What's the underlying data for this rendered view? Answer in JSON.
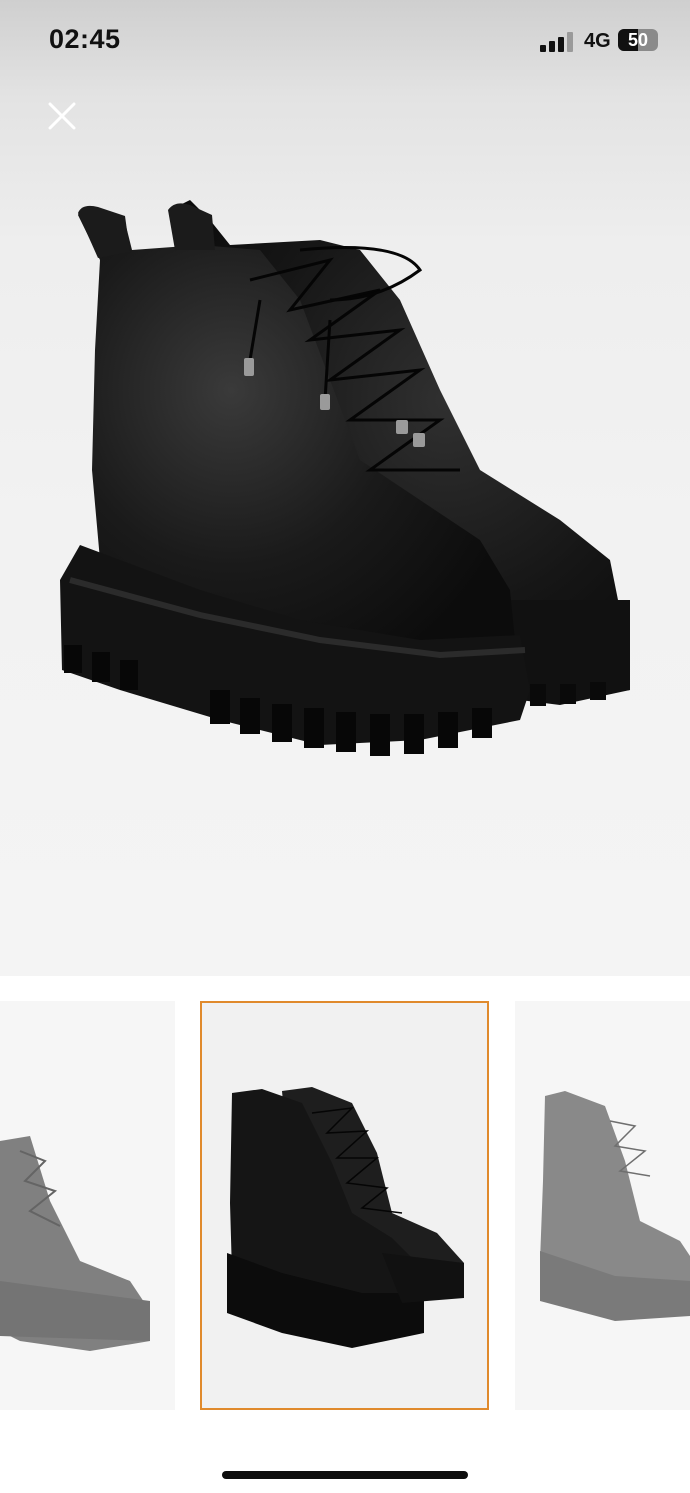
{
  "status_bar": {
    "time": "02:45",
    "network": "4G",
    "battery_level": "50"
  },
  "close_button": {
    "icon": "close-icon"
  },
  "main_image": {
    "subject": "boot-icon"
  },
  "gallery": {
    "thumbnails": [
      {
        "icon": "boot-thumbnail-icon"
      },
      {
        "icon": "boot-thumbnail-icon"
      },
      {
        "icon": "boot-thumbnail-icon"
      }
    ],
    "selected_index": 1,
    "accent_color": "#e08a2c"
  }
}
